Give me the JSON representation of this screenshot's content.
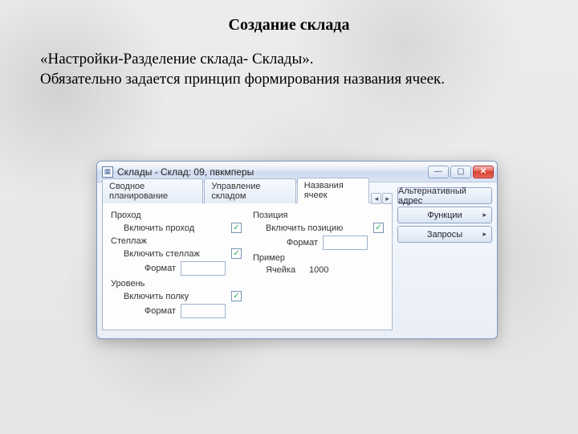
{
  "page": {
    "title": "Создание склада",
    "para_line1": "«Настройки-Разделение склада- Склады».",
    "para_line2": "Обязательно задается принцип формирования названия ячеек."
  },
  "window": {
    "title": "Склады - Склад: 09, пвкмперы",
    "tabs": {
      "t1": "Сводное планирование",
      "t2": "Управление складом",
      "t3": "Названия ячеек"
    },
    "form": {
      "left": {
        "aisle_label": "Проход",
        "include_aisle_label": "Включить проход",
        "include_aisle_checked": "✓",
        "rack_label": "Стеллаж",
        "include_rack_label": "Включить стеллаж",
        "include_rack_checked": "✓",
        "format_label": "Формат",
        "aisle_format": "",
        "rack_format": "",
        "level_label": "Уровень",
        "include_shelf_label": "Включить полку",
        "include_shelf_checked": "✓",
        "shelf_format": ""
      },
      "right": {
        "position_label": "Позиция",
        "include_position_label": "Включить позицию",
        "include_position_checked": "✓",
        "format_label": "Формат",
        "position_format": "",
        "example_label": "Пример",
        "cell_label": "Ячейка",
        "cell_value": "1000"
      }
    },
    "side": {
      "alt_address": "Альтернативный адрес",
      "functions": "Функции",
      "queries": "Запросы"
    }
  }
}
